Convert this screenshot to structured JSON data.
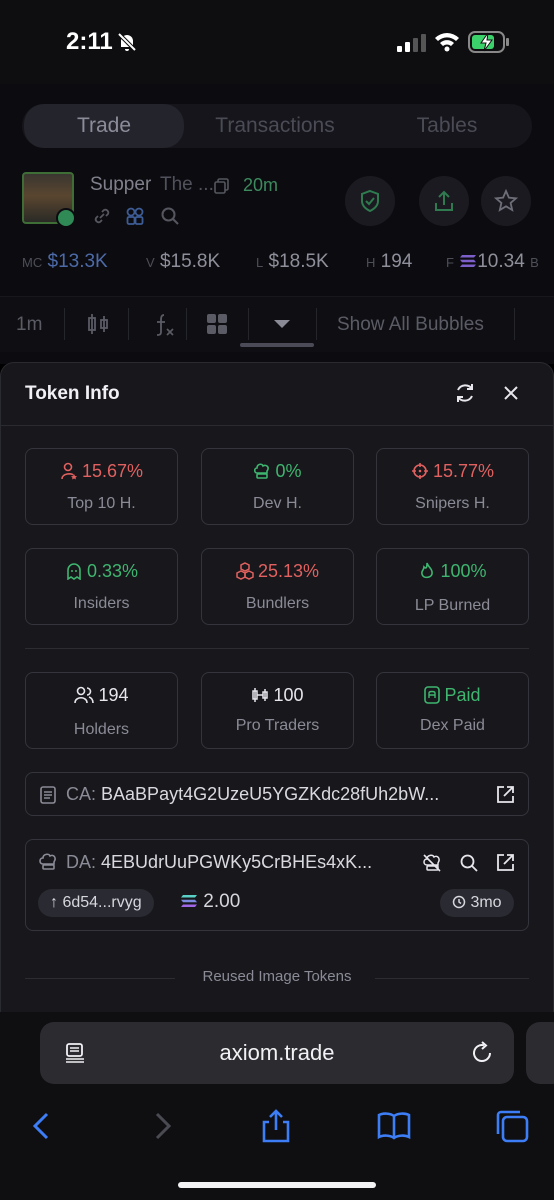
{
  "status_bar": {
    "time": "2:11"
  },
  "app": {
    "tabs": [
      {
        "label": "Trade",
        "active": true
      },
      {
        "label": "Transactions",
        "active": false
      },
      {
        "label": "Tables",
        "active": false
      }
    ],
    "token": {
      "name": "Supper",
      "subtitle": "The ...",
      "age": "20m"
    },
    "metrics": [
      {
        "label": "MC",
        "value": "$13.3K"
      },
      {
        "label": "V",
        "value": "$15.8K"
      },
      {
        "label": "L",
        "value": "$18.5K"
      },
      {
        "label": "H",
        "value": "194"
      },
      {
        "label": "F",
        "value": "10.34"
      },
      {
        "label": "B",
        "value": ""
      }
    ],
    "toolbar": {
      "interval": "1m",
      "bubbles": "Show All Bubbles"
    }
  },
  "panel": {
    "title": "Token Info",
    "stats": [
      {
        "value": "15.67%",
        "label": "Top 10 H.",
        "color": "#e0615f",
        "icon": "user-star-icon"
      },
      {
        "value": "0%",
        "label": "Dev H.",
        "color": "#3fb56f",
        "icon": "chef-hat-icon"
      },
      {
        "value": "15.77%",
        "label": "Snipers H.",
        "color": "#e0615f",
        "icon": "crosshair-icon"
      },
      {
        "value": "0.33%",
        "label": "Insiders",
        "color": "#3fb56f",
        "icon": "ghost-icon"
      },
      {
        "value": "25.13%",
        "label": "Bundlers",
        "color": "#e0615f",
        "icon": "boxes-icon"
      },
      {
        "value": "100%",
        "label": "LP Burned",
        "color": "#3fb56f",
        "icon": "flame-icon"
      }
    ],
    "stats2": [
      {
        "value": "194",
        "label": "Holders",
        "icon": "users-icon"
      },
      {
        "value": "100",
        "label": "Pro Traders",
        "icon": "candles-icon"
      },
      {
        "value": "Paid",
        "label": "Dex Paid",
        "icon": "dex-badge-icon",
        "color": "#3fb56f"
      }
    ],
    "ca": {
      "prefix": "CA:",
      "value": "BAaBPayt4G2UzeU5YGZKdc28fUh2bW..."
    },
    "da": {
      "prefix": "DA:",
      "value": "4EBUdrUuPGWKy5CrBHEs4xK...",
      "funder": "6d54...rvyg",
      "amount": "2.00",
      "age": "3mo"
    },
    "reused_label": "Reused Image Tokens"
  },
  "browser": {
    "url": "axiom.trade"
  }
}
